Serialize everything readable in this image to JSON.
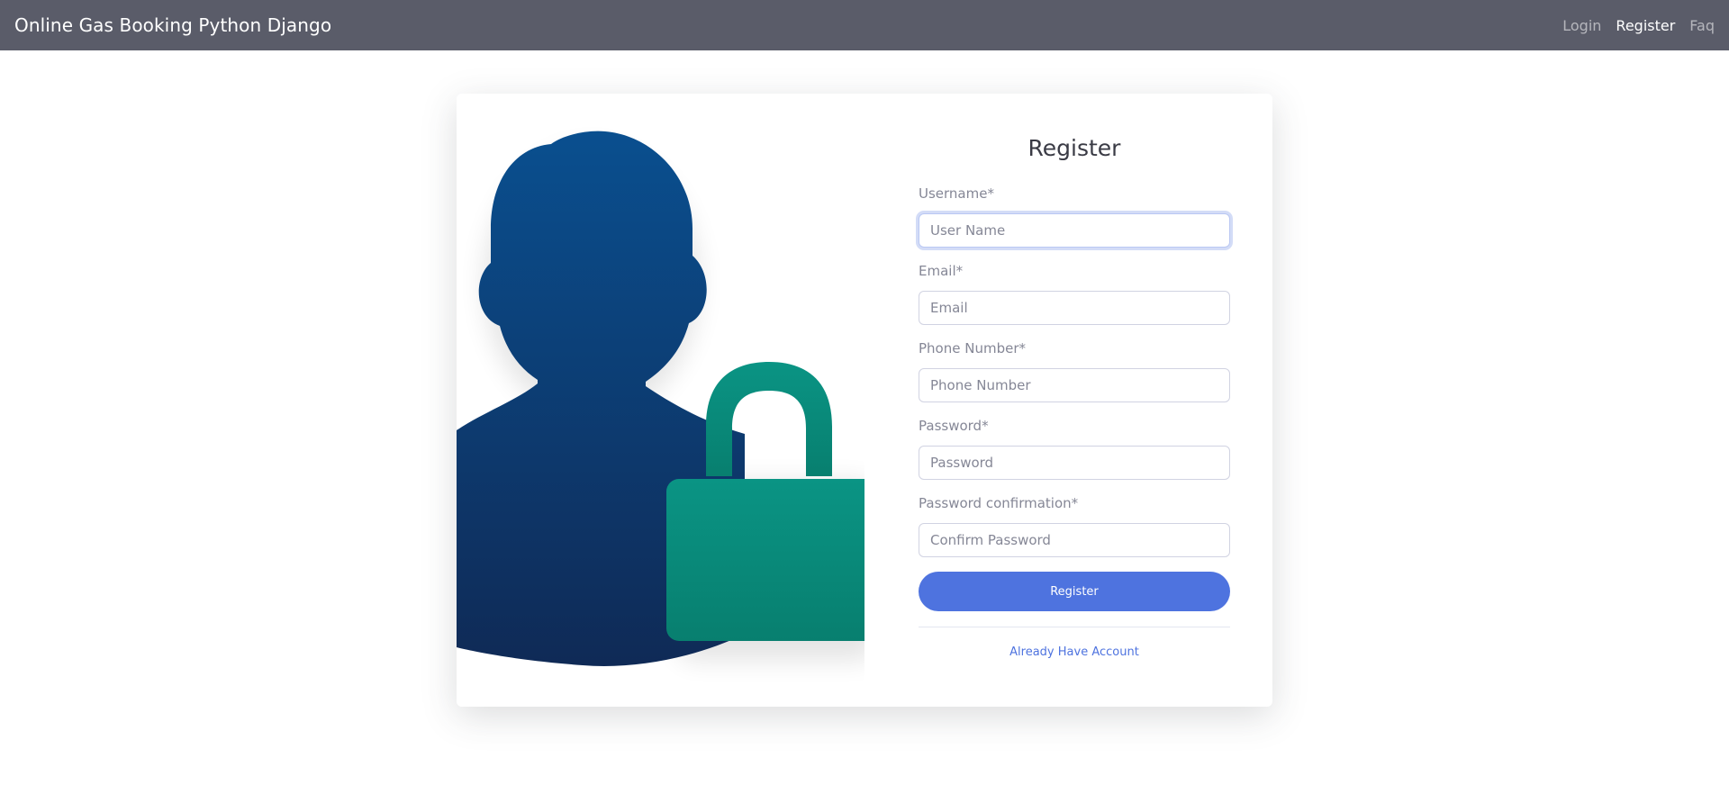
{
  "navbar": {
    "brand": "Online Gas Booking Python Django",
    "links": [
      "Login",
      "Register",
      "Faq"
    ]
  },
  "illustration": {
    "icon": "user-lock-icon",
    "colors": {
      "person_top": "#0a4f8f",
      "person_bottom": "#0f2a56",
      "lock": "#0a8f80"
    }
  },
  "form": {
    "title": "Register",
    "fields": [
      {
        "label": "Username*",
        "placeholder": "User Name"
      },
      {
        "label": "Email*",
        "placeholder": "Email"
      },
      {
        "label": "Phone Number*",
        "placeholder": "Phone Number"
      },
      {
        "label": "Password*",
        "placeholder": "Password"
      },
      {
        "label": "Password confirmation*",
        "placeholder": "Confirm Password"
      }
    ],
    "submit_label": "Register",
    "account_link": "Already Have Account"
  },
  "colors": {
    "navbar": "#5a5c69",
    "primary": "#4e73df"
  }
}
